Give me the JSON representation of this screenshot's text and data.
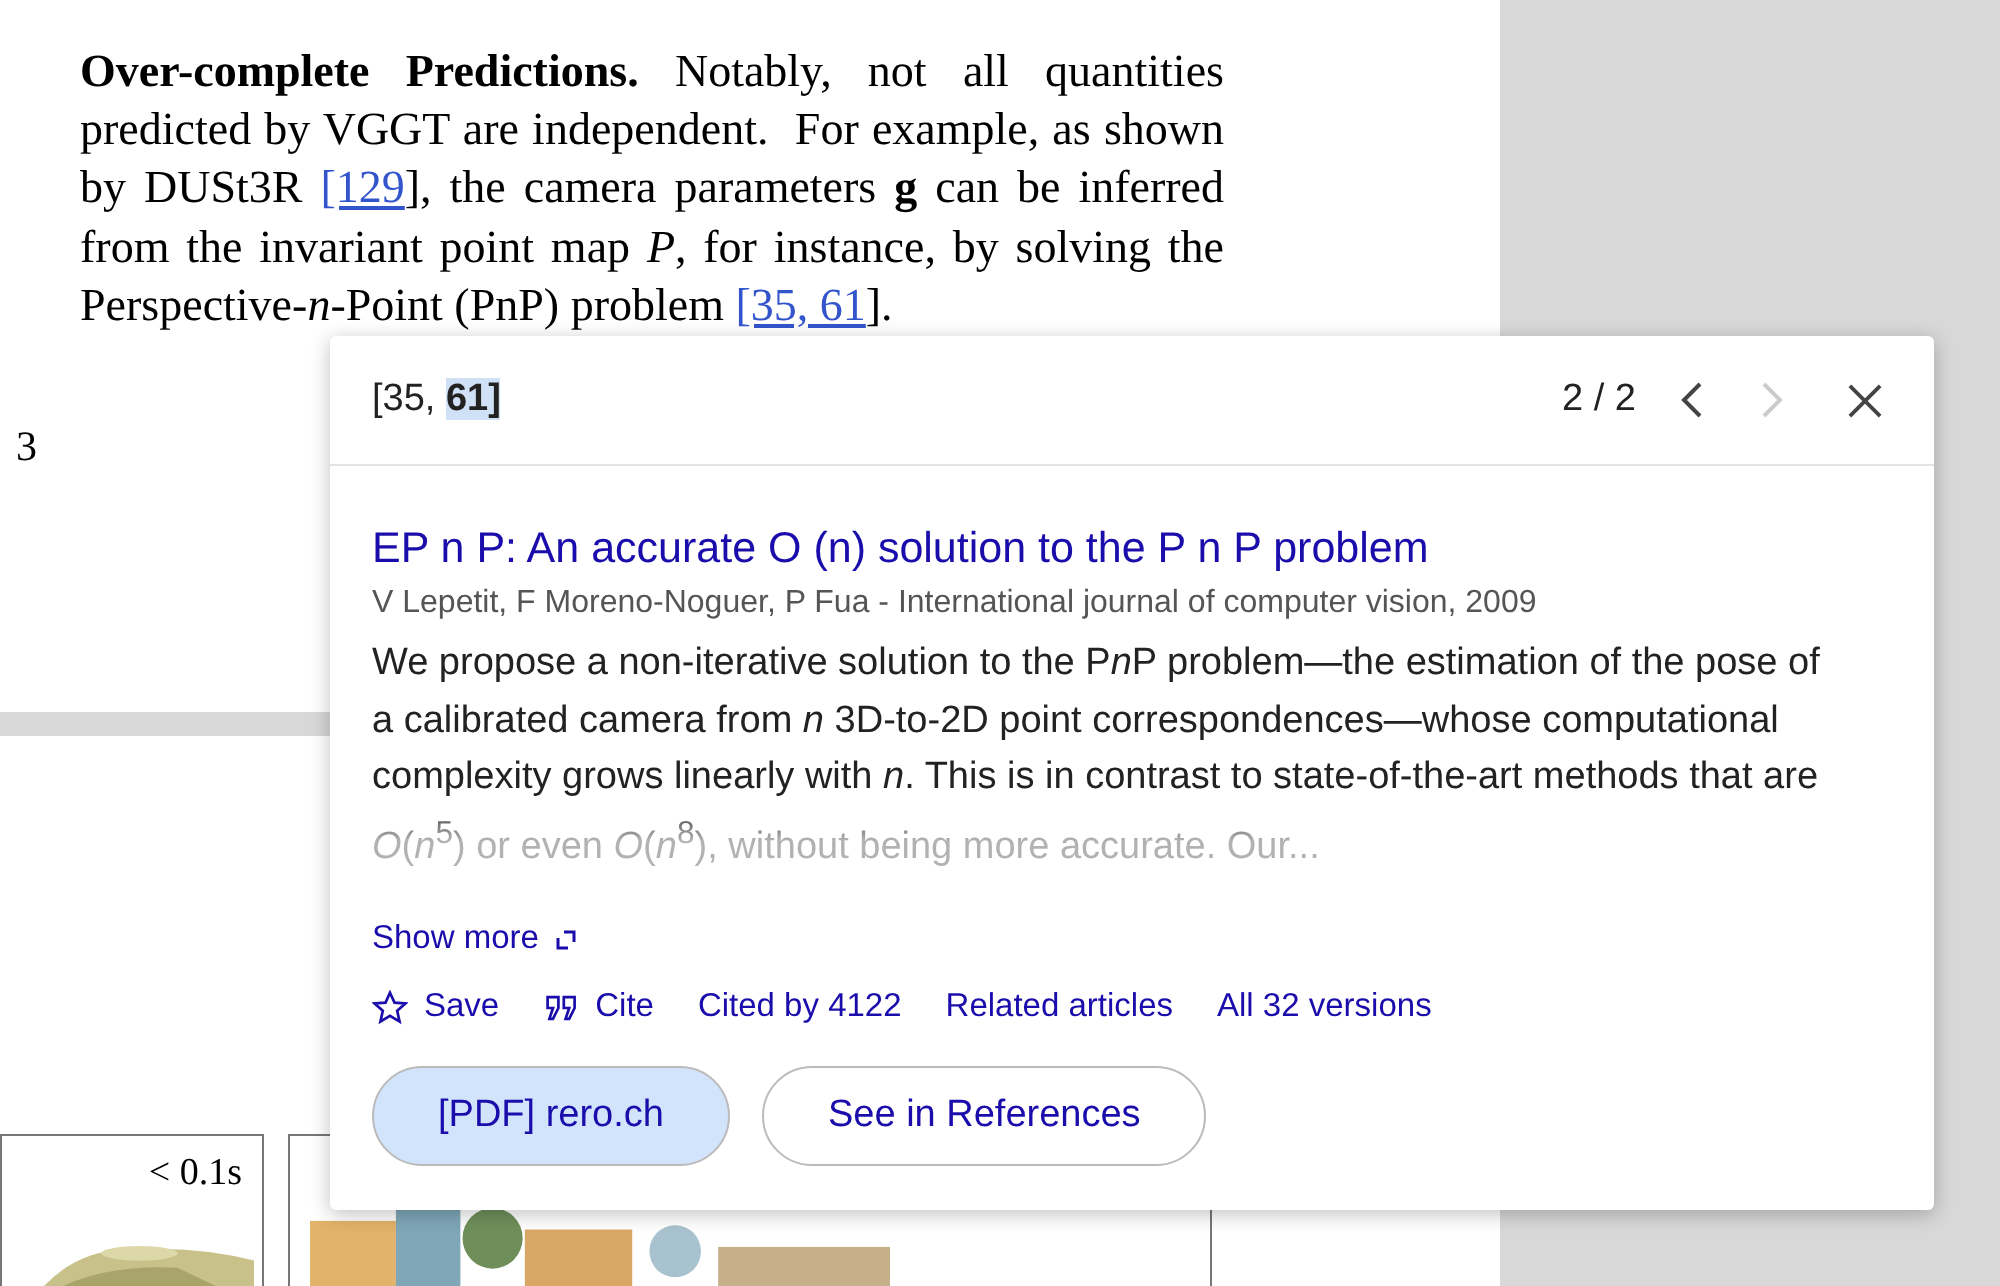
{
  "paper": {
    "paragraph": [
      {
        "kind": "text",
        "text": "**Over-complete Predictions.** Notably, not all quantities predicted by VGGT are independent.  For example, as shown by DUSt3R "
      },
      {
        "kind": "link",
        "text": "[129"
      },
      {
        "kind": "text",
        "text": "], the camera parameters **g** can be inferred from the invariant point map *P*, for instance, by solving the Perspective-*n*-Point (PnP) problem "
      },
      {
        "kind": "link",
        "text": "[35, 61"
      },
      {
        "kind": "text",
        "text": "]."
      }
    ],
    "page_number": "3",
    "figure": {
      "time_label": "< 0.1s"
    }
  },
  "popup": {
    "citation_prefix": "[35, ",
    "citation_current": "61]",
    "pager": "2 / 2",
    "prev": {
      "disabled": false
    },
    "next": {
      "disabled": true
    },
    "title": "EP n P: An accurate O (n) solution to the P n P problem",
    "authors": "V Lepetit, F Moreno-Noguer, P Fua - International journal of computer vision, 2009",
    "abstract": [
      {
        "kind": "plain",
        "text": "We propose a non-iterative solution to the P"
      },
      {
        "kind": "italic",
        "text": "n"
      },
      {
        "kind": "plain",
        "text": "P problem—the estimation of the pose of a calibrated camera from *n* 3D-to-2D point correspondences—whose computational complexity grows linearly with *n*. This is in contrast to state-of-the-art methods that are *O*(*n*$^{5}$) or even *O*(*n*$^{8}$), without being more accurate. Our..."
      }
    ],
    "show_more": "Show more",
    "actions": [
      {
        "kind": "save",
        "label": "Save"
      },
      {
        "kind": "cite",
        "label": "Cite"
      },
      {
        "kind": "plain",
        "label": "Cited by 4122"
      },
      {
        "kind": "plain",
        "label": "Related articles"
      },
      {
        "kind": "plain",
        "label": "All 32 versions"
      }
    ],
    "buttons": [
      {
        "kind": "filled",
        "label": "[PDF] rero.ch"
      },
      {
        "kind": "outline",
        "label": "See in References"
      }
    ]
  }
}
